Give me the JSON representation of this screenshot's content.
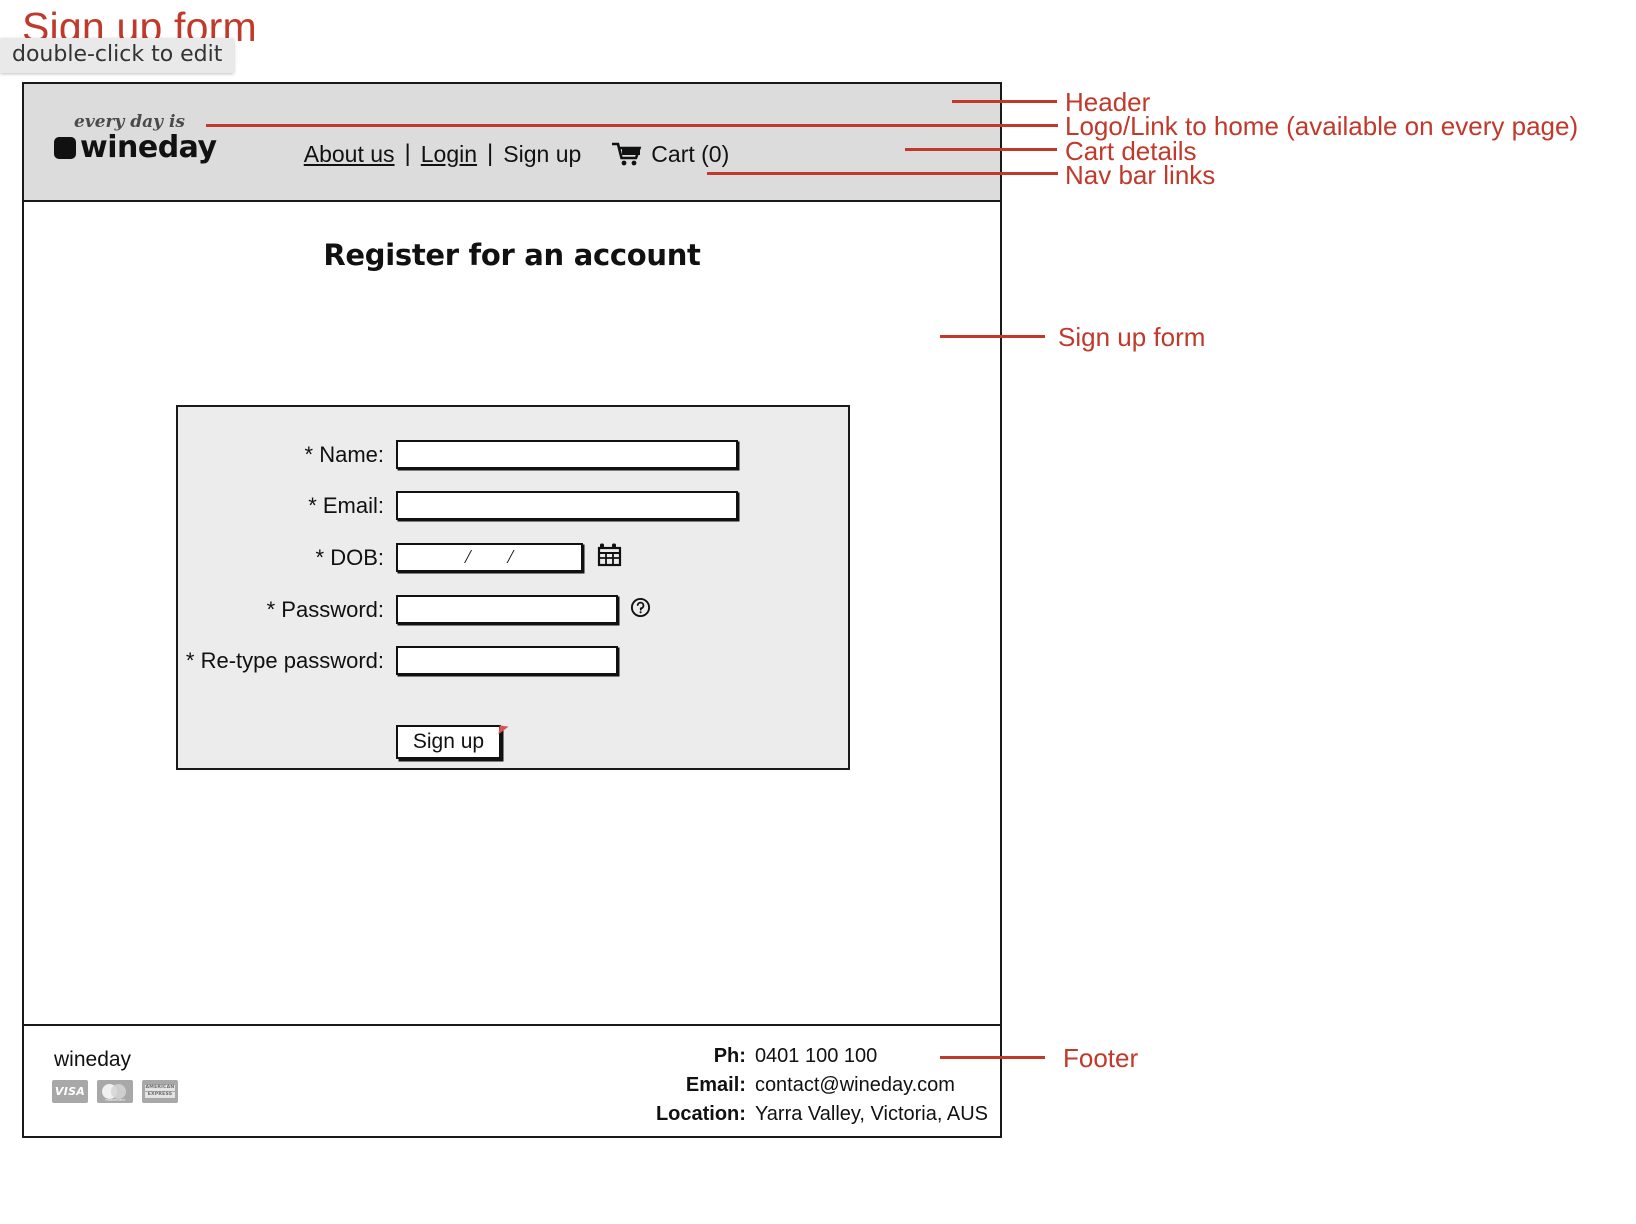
{
  "page": {
    "title": "Sign up form",
    "edit_hint": "double-click to edit"
  },
  "header": {
    "logo": {
      "tagline": "every day is",
      "name": "wineday",
      "icon": "rounded-square-logo-mark"
    },
    "nav": {
      "about": "About us",
      "login": "Login",
      "signup": "Sign up",
      "separator": "|",
      "cart_label": "Cart (0)",
      "cart_icon": "shopping-cart-icon"
    }
  },
  "main": {
    "heading": "Register for an account",
    "fields": [
      {
        "label": "* Name:",
        "value": "",
        "type": "text",
        "name": "name"
      },
      {
        "label": "* Email:",
        "value": "",
        "type": "text",
        "name": "email"
      },
      {
        "label": "* DOB:",
        "value": "",
        "type": "date",
        "name": "dob",
        "mask_sep": "/",
        "trailing_icon": "calendar-icon"
      },
      {
        "label": "* Password:",
        "value": "",
        "type": "password",
        "name": "password",
        "trailing_icon": "help-circle-icon"
      },
      {
        "label": "* Re-type password:",
        "value": "",
        "type": "password",
        "name": "retype-password"
      }
    ],
    "submit_label": "Sign up"
  },
  "footer": {
    "brand": "wineday",
    "payment_icons": [
      {
        "name": "visa-icon",
        "label": "VISA"
      },
      {
        "name": "mastercard-icon",
        "label": "mastercard"
      },
      {
        "name": "amex-icon",
        "label_top": "AMERICAN",
        "label_bottom": "EXPRESS"
      }
    ],
    "contact": [
      {
        "key": "Ph:",
        "value": "0401 100 100"
      },
      {
        "key": "Email:",
        "value": "contact@wineday.com"
      },
      {
        "key": "Location:",
        "value": "Yarra Valley, Victoria, AUS"
      }
    ]
  },
  "annotations": [
    {
      "text": "Header",
      "name": "annotation-header"
    },
    {
      "text": "Logo/Link to home (available on every page)",
      "name": "annotation-logo"
    },
    {
      "text": "Cart details",
      "name": "annotation-cart"
    },
    {
      "text": "Nav bar links",
      "name": "annotation-navbar"
    },
    {
      "text": "Sign up form",
      "name": "annotation-signup-form"
    },
    {
      "text": "Footer",
      "name": "annotation-footer"
    }
  ],
  "colors": {
    "annotation": "#c0392b",
    "header_bg": "#dcdcdc",
    "panel_bg": "#ececec",
    "outline": "#1a1a1a"
  }
}
